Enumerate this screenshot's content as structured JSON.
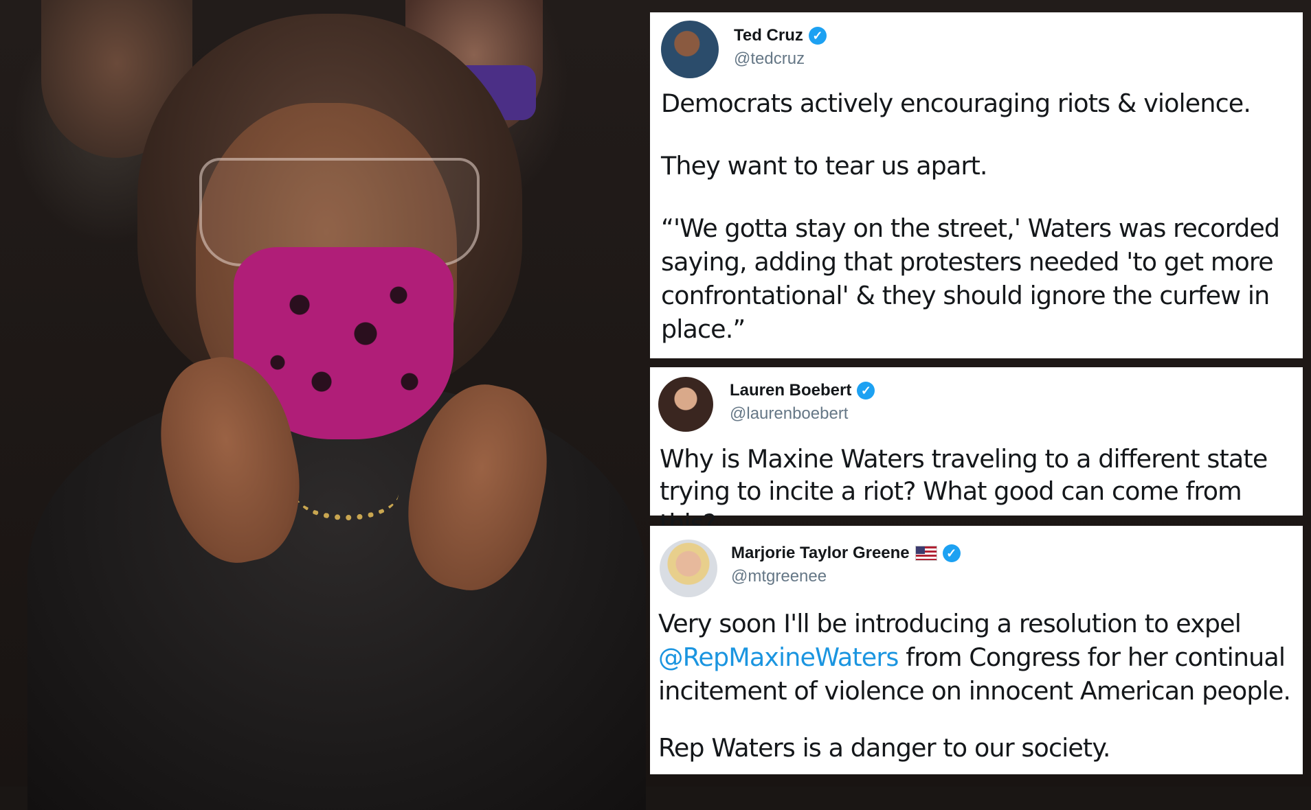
{
  "tweets": [
    {
      "name": "Ted Cruz",
      "handle": "@tedcruz",
      "paragraphs": [
        "Democrats actively encouraging riots & violence.",
        "They want to tear us apart.",
        "“'We gotta stay on the street,' Waters was recorded saying, adding that protesters needed 'to get more confrontational' & they should ignore the curfew in place.”"
      ]
    },
    {
      "name": "Lauren Boebert",
      "handle": "@laurenboebert",
      "paragraphs": [
        "Why is Maxine Waters traveling to a different state trying to incite a riot? What good can come from this?"
      ]
    },
    {
      "name": "Marjorie Taylor Greene",
      "handle": "@mtgreenee",
      "p1_before": "Very soon I'll be introducing a resolution to expel ",
      "p1_mention": "@RepMaxineWaters",
      "p1_after": " from Congress for her continual incitement of violence on innocent American people.",
      "p2": "Rep Waters is a danger to our society."
    }
  ],
  "colors": {
    "verified": "#1da1f2",
    "mention": "#1b95e0",
    "handle": "#657786",
    "mask": "#b01e78"
  },
  "icons": [
    "verified-badge-icon",
    "us-flag-icon"
  ]
}
